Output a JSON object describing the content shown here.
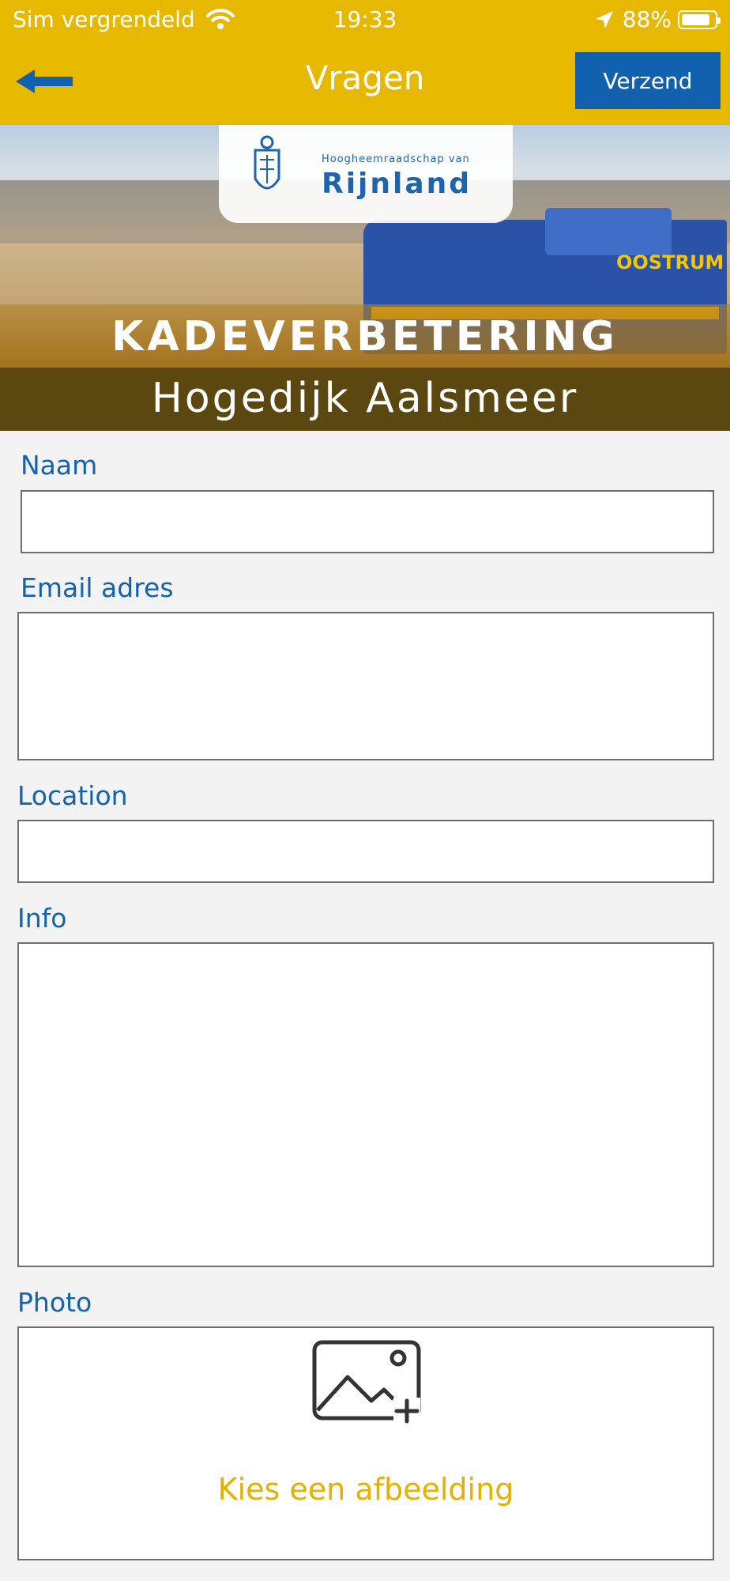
{
  "status_bar": {
    "carrier": "Sim vergrendeld",
    "time": "19:33",
    "battery": "88%"
  },
  "nav": {
    "title": "Vragen",
    "send_label": "Verzend"
  },
  "banner": {
    "logo_subtitle": "Hoogheemraadschap van",
    "logo_brand": "Rijnland",
    "vehicle_logo": "OOSTRUM",
    "title": "KADEVERBETERING",
    "subtitle": "Hogedijk Aalsmeer"
  },
  "form": {
    "name_label": "Naam",
    "email_label": "Email adres",
    "location_label": "Location",
    "info_label": "Info",
    "photo_label": "Photo",
    "photo_cta": "Kies een afbeelding"
  },
  "colors": {
    "header": "#e6b800",
    "send_button": "#1261ae",
    "label": "#1163af",
    "cta": "#e5b100"
  }
}
